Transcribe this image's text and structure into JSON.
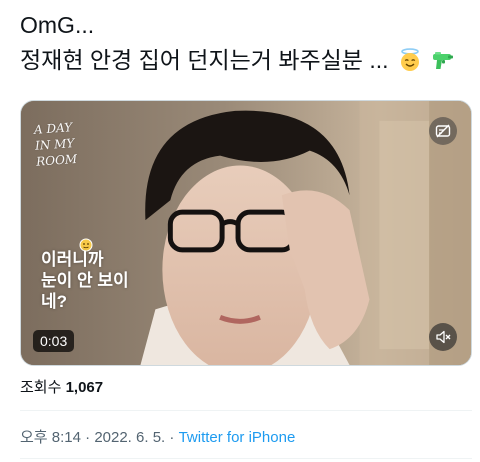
{
  "tweet": {
    "text_line1": "OmG...",
    "text_line2": "정재현 안경 집어 던지는거 봐주실분 ...",
    "emojis": [
      "smiling-face-with-halo",
      "water-pistol"
    ]
  },
  "media": {
    "overlay_title_line1": "A DAY",
    "overlay_title_line2": "IN MY ROOM",
    "caption_line1": "이러니까",
    "caption_line2": "눈이 안 보이네?",
    "timestamp": "0:03",
    "icons": [
      "captions-icon",
      "mute-icon"
    ]
  },
  "stats": {
    "views_label": "조회수",
    "views_count": "1,067"
  },
  "meta": {
    "time": "오후 8:14",
    "separator1": " · ",
    "date": "2022. 6. 5.",
    "separator2": " · ",
    "source": "Twitter for iPhone"
  },
  "colors": {
    "link": "#1d9bf0",
    "secondary_text": "#536471",
    "primary_text": "#0f1419"
  }
}
